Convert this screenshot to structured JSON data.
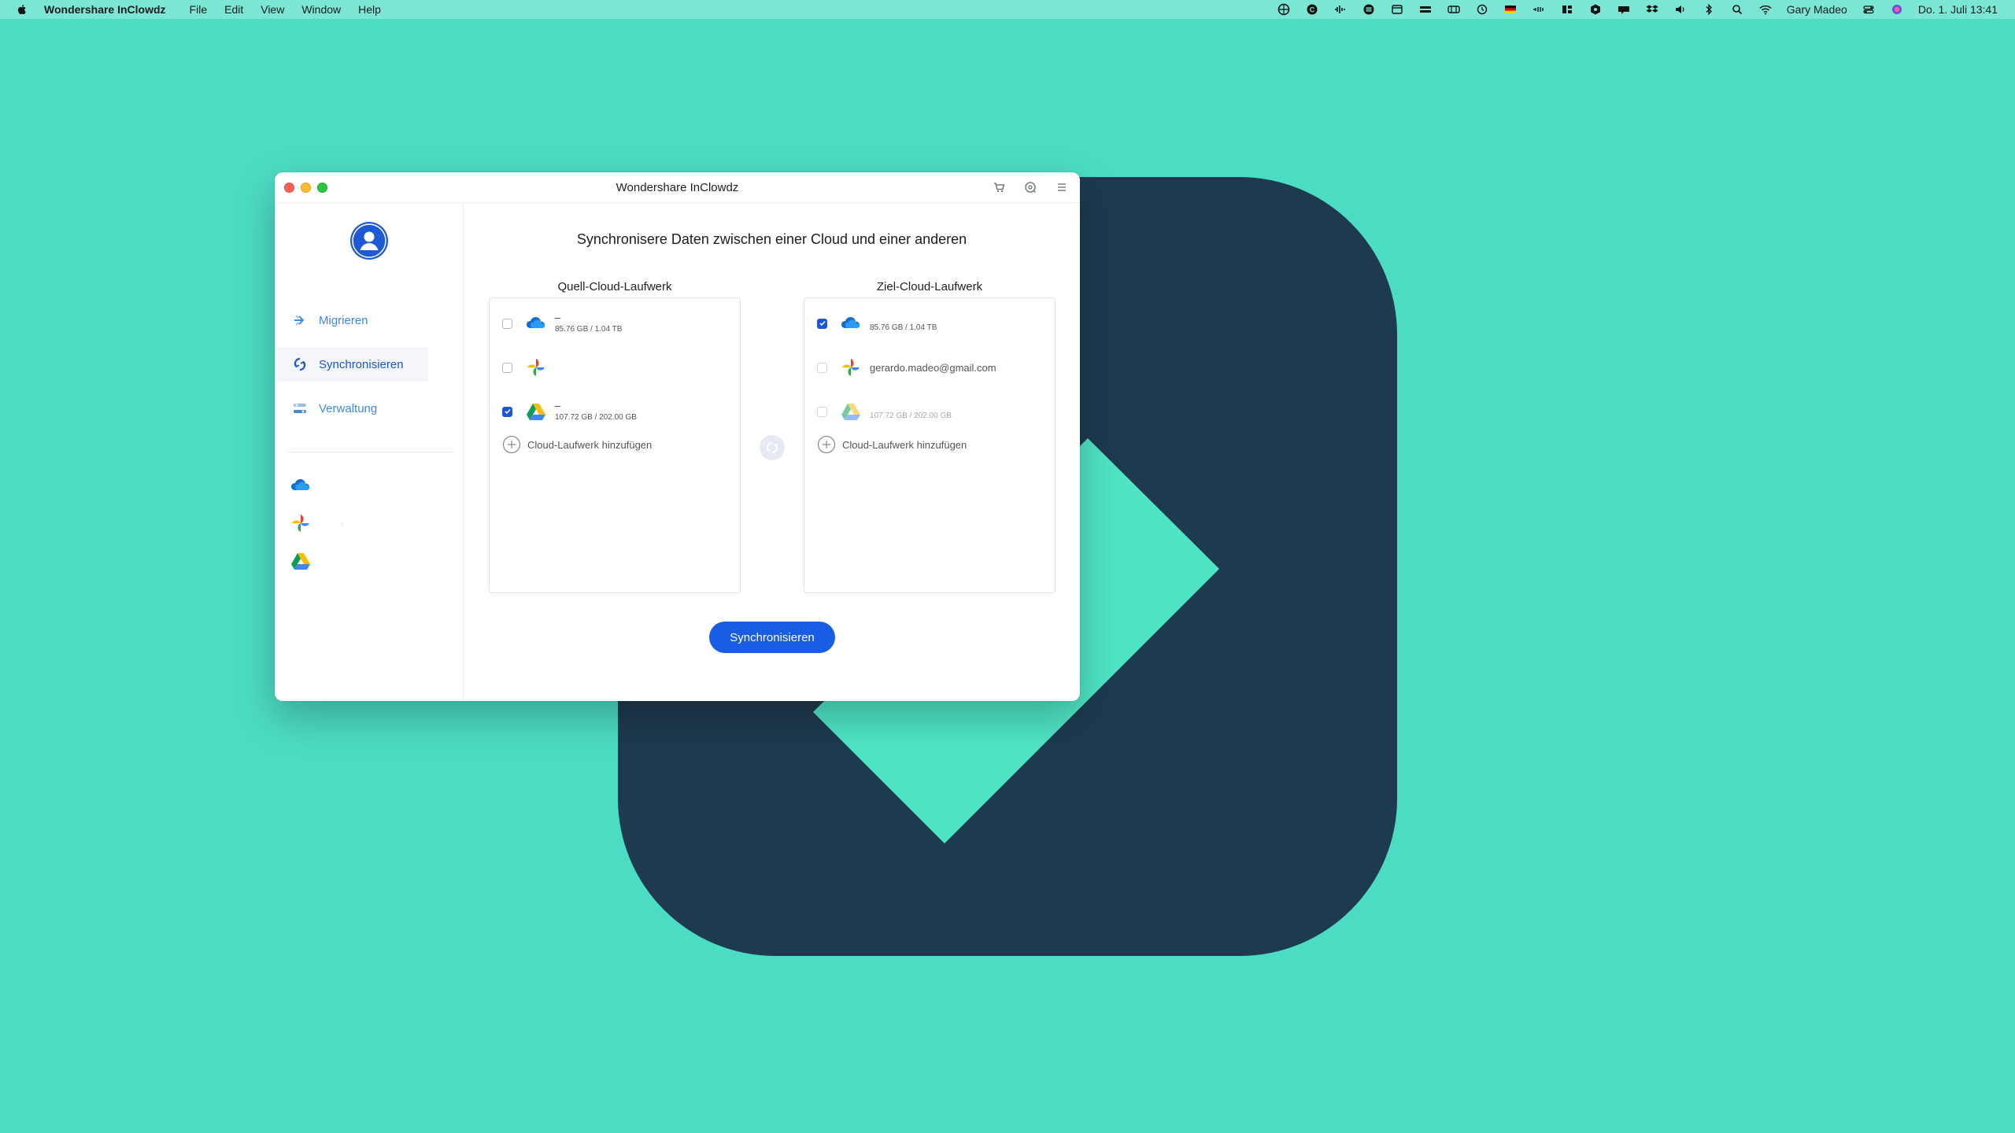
{
  "menubar": {
    "app_name": "Wondershare InClowdz",
    "menus": [
      "File",
      "Edit",
      "View",
      "Window",
      "Help"
    ],
    "user": "Gary Madeo",
    "datetime": "Do. 1. Juli  13:41"
  },
  "window": {
    "title": "Wondershare InClowdz"
  },
  "sidebar": {
    "nav": [
      {
        "label": "Migrieren",
        "icon": "migrate-icon"
      },
      {
        "label": "Synchronisieren",
        "icon": "sync-icon",
        "active": true
      },
      {
        "label": "Verwaltung",
        "icon": "manage-icon"
      }
    ],
    "accounts": [
      {
        "icon": "onedrive-icon"
      },
      {
        "icon": "google-photos-icon"
      },
      {
        "icon": "google-drive-icon"
      }
    ]
  },
  "main": {
    "heading": "Synchronisere Daten zwischen einer Cloud und einer anderen",
    "source": {
      "title": "Quell-Cloud-Laufwerk",
      "drives": [
        {
          "name": "–",
          "usage": "85.76 GB / 1.04 TB",
          "checked": false,
          "icon": "onedrive-icon"
        },
        {
          "name": "",
          "usage": "",
          "checked": false,
          "icon": "google-photos-icon"
        },
        {
          "name": "–",
          "usage": "107.72 GB / 202.00 GB",
          "checked": true,
          "icon": "google-drive-icon"
        }
      ],
      "add_label": "Cloud-Laufwerk hinzufügen"
    },
    "target": {
      "title": "Ziel-Cloud-Laufwerk",
      "drives": [
        {
          "name": "",
          "usage": "85.76 GB / 1.04 TB",
          "checked": true,
          "icon": "onedrive-icon"
        },
        {
          "name": "gerardo.madeo@gmail.com",
          "usage": "",
          "checked": false,
          "icon": "google-photos-icon"
        },
        {
          "name": "",
          "usage": "107.72 GB / 202.00 GB",
          "checked": false,
          "icon": "google-drive-icon"
        }
      ],
      "add_label": "Cloud-Laufwerk hinzufügen"
    },
    "sync_button": "Synchronisieren"
  },
  "colors": {
    "desktop": "#4cdcc4",
    "logo_dark": "#1e3a4f",
    "accent": "#1a5de5"
  }
}
